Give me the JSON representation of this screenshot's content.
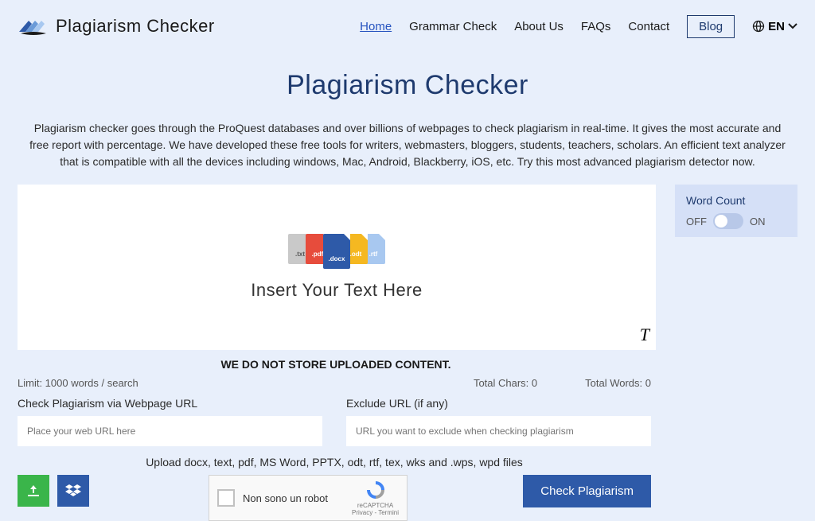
{
  "header": {
    "brand": "Plagiarism Checker",
    "nav": {
      "home": "Home",
      "grammar": "Grammar Check",
      "about": "About Us",
      "faqs": "FAQs",
      "contact": "Contact",
      "blog": "Blog",
      "lang": "EN"
    }
  },
  "main": {
    "title": "Plagiarism Checker",
    "description": "Plagiarism checker goes through the ProQuest databases and over billions of webpages to check plagiarism in real-time. It gives the most accurate and free report with percentage. We have developed these free tools for writers, webmasters, bloggers, students, teachers, scholars. An efficient text analyzer that is compatible with all the devices including windows, Mac, Android, Blackberry, iOS, etc. Try this most advanced plagiarism detector now.",
    "editor_placeholder": "Insert Your Text Here",
    "file_exts": {
      "txt": ".txt",
      "pdf": ".pdf",
      "docx": ".docx",
      "odt": ".odt",
      "rtf": ".rtf"
    }
  },
  "sidebar": {
    "word_count_title": "Word Count",
    "off": "OFF",
    "on": "ON"
  },
  "notice": "WE DO NOT STORE UPLOADED CONTENT.",
  "stats": {
    "limit": "Limit: 1000 words / search",
    "chars": "Total Chars: 0",
    "words": "Total Words: 0"
  },
  "urls": {
    "check_label": "Check Plagiarism via Webpage URL",
    "check_placeholder": "Place your web URL here",
    "exclude_label": "Exclude URL (if any)",
    "exclude_placeholder": "URL you want to exclude when checking plagiarism"
  },
  "upload_hint": "Upload docx, text, pdf, MS Word, PPTX, odt, rtf, tex, wks and .wps, wpd files",
  "recaptcha": {
    "label": "Non sono un robot",
    "brand": "reCAPTCHA",
    "terms": "Privacy - Termini"
  },
  "check_button": "Check Plagiarism"
}
